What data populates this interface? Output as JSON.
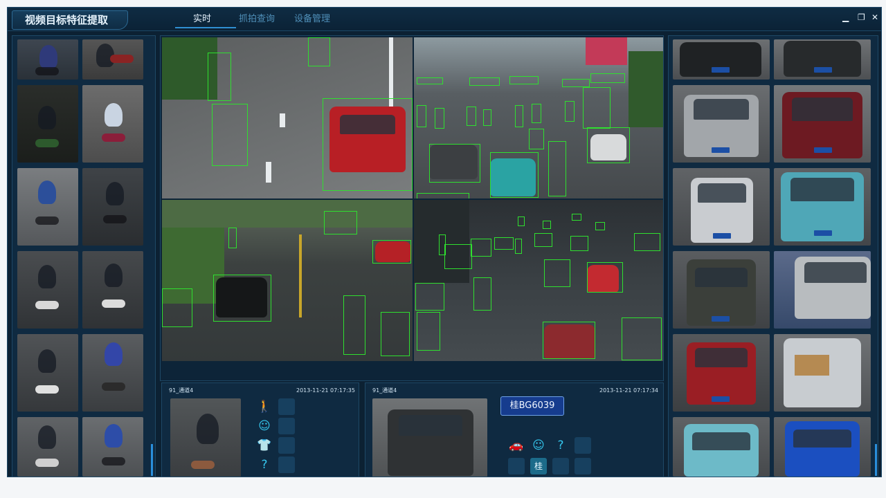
{
  "app": {
    "title": "视频目标特征提取"
  },
  "tabs": [
    {
      "label": "实时",
      "active": true
    },
    {
      "label": "抓拍查询",
      "active": false
    },
    {
      "label": "设备管理",
      "active": false
    }
  ],
  "window_controls": {
    "minimize": "▁",
    "restore": "❐",
    "close": "✕"
  },
  "left_panel": {
    "kind": "person-captures",
    "count": 12
  },
  "right_panel": {
    "kind": "vehicle-captures",
    "count": 12
  },
  "video_grid": {
    "views": [
      "street-motorbikes",
      "crossing-traffic",
      "residential-road",
      "intersection-overview"
    ],
    "layout_buttons": [
      "1-view",
      "4-view",
      "6-view",
      "8-view",
      "9-view",
      "13-view",
      "16-view"
    ]
  },
  "person_detail": {
    "camera": "91_通道4",
    "timestamp": "2013-11-21 07:17:35",
    "attribute_icons": [
      "person-icon",
      "face-icon",
      "shirt-icon",
      "question-icon"
    ]
  },
  "vehicle_detail": {
    "camera": "91_通道4",
    "timestamp": "2013-11-21 07:17:34",
    "plate": "桂BG6039",
    "attribute_icons": [
      "car-icon",
      "driver-icon",
      "question-icon",
      "plate-icon"
    ],
    "plate_icon_text": "桂"
  },
  "colors": {
    "background": "#0c2133",
    "panel": "#0f2a41",
    "accent": "#2f8fd2",
    "detection_box": "#2fe02f",
    "icon": "#35c8ef"
  }
}
